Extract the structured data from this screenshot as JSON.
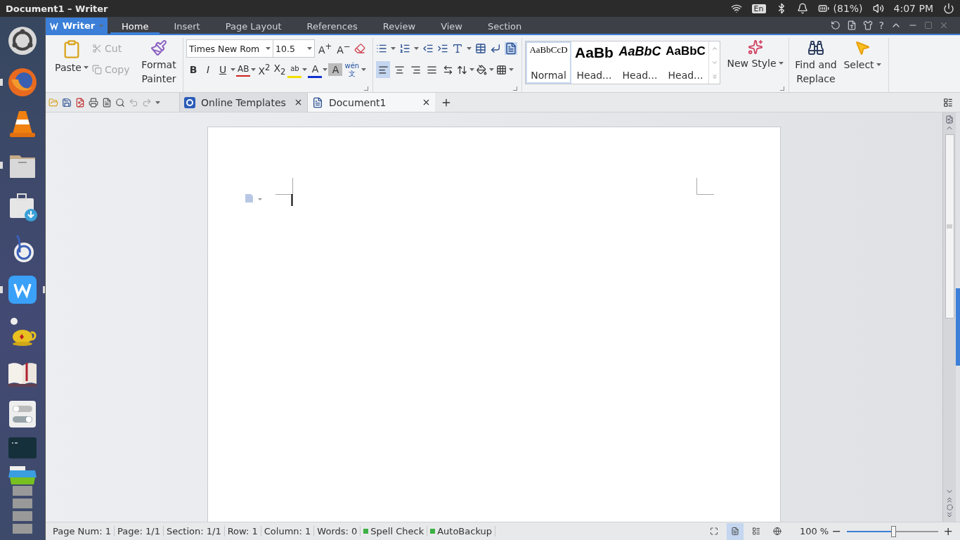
{
  "topbar": {
    "title": "Document1 – Writer",
    "keyboard": "En",
    "battery": "(81%)",
    "time": "4:07 PM"
  },
  "dock": [
    {
      "kind": "ubuntu",
      "running": false,
      "active": false
    },
    {
      "kind": "firefox",
      "running": true,
      "active": false
    },
    {
      "kind": "cone",
      "running": false,
      "active": false
    },
    {
      "kind": "files",
      "running": true,
      "active": false
    },
    {
      "kind": "installer",
      "running": false,
      "active": false
    },
    {
      "kind": "bapp",
      "running": false,
      "active": false
    },
    {
      "kind": "writer",
      "running": true,
      "active": true
    },
    {
      "kind": "teapot",
      "running": false,
      "active": false
    },
    {
      "kind": "book",
      "running": false,
      "active": false
    },
    {
      "kind": "settings",
      "running": false,
      "active": false
    },
    {
      "kind": "terminal",
      "running": false,
      "active": false
    },
    {
      "kind": "stack",
      "running": false,
      "active": false
    }
  ],
  "menubar": {
    "app_button": "Writer",
    "tabs": [
      {
        "label": "Home",
        "selected": true
      },
      {
        "label": "Insert",
        "selected": false
      },
      {
        "label": "Page Layout",
        "selected": false
      },
      {
        "label": "References",
        "selected": false
      },
      {
        "label": "Review",
        "selected": false
      },
      {
        "label": "View",
        "selected": false
      },
      {
        "label": "Section",
        "selected": false
      }
    ],
    "help": "?"
  },
  "ribbon": {
    "clipboard": {
      "paste": "Paste",
      "cut": {
        "label": "Cut",
        "disabled": true
      },
      "copy": {
        "label": "Copy",
        "disabled": true
      },
      "format_painter": "Format Painter"
    },
    "font": {
      "name": "Times New Rom",
      "size": "10.5",
      "grow": "A$^{+}$",
      "shrink": "A$^{−}$",
      "bold": "B",
      "italic": "I",
      "underline": "U",
      "strikethrough": "AB",
      "superscript": "X$^{2}$",
      "subscript": "X$_{2}$",
      "highlight": "ab",
      "font_color": "A",
      "char_shading": "A",
      "phonetic_top": "wén",
      "phonetic_bottom": "文"
    },
    "alignment": [
      {
        "kind": "left",
        "selected": true
      },
      {
        "kind": "center",
        "selected": false
      },
      {
        "kind": "right",
        "selected": false
      },
      {
        "kind": "justify",
        "selected": false
      },
      {
        "kind": "distributed",
        "selected": false
      }
    ],
    "styles": [
      {
        "kind": "normal",
        "preview": "AaBbCcD",
        "label": "Normal",
        "selected": true
      },
      {
        "kind": "heading1",
        "preview": "AaBb",
        "label": "Head...",
        "selected": false
      },
      {
        "kind": "heading2",
        "preview": "AaBbC",
        "label": "Head...",
        "selected": false
      },
      {
        "kind": "heading3",
        "preview": "AaBbC",
        "label": "Head...",
        "selected": false
      }
    ],
    "new_style": "New Style",
    "find_replace": "Find and Replace",
    "select": "Select"
  },
  "doc_tabs": [
    {
      "label": "Online Templates",
      "kind": "templates",
      "selected": false
    },
    {
      "label": "Document1",
      "kind": "document",
      "selected": true
    }
  ],
  "status": {
    "fields": [
      "Page Num: 1",
      "Page: 1/1",
      "Section: 1/1",
      "Row: 1",
      "Column: 1",
      "Words: 0"
    ],
    "indicators": [
      "Spell Check",
      "AutoBackup"
    ],
    "views": [
      {
        "kind": "fullscreen",
        "selected": false
      },
      {
        "kind": "page",
        "selected": true
      },
      {
        "kind": "outline",
        "selected": false
      },
      {
        "kind": "web",
        "selected": false
      }
    ],
    "zoom": "100 %",
    "zoom_out": "−",
    "zoom_in": "+",
    "zoom_level": {
      "level": 0.51
    }
  }
}
